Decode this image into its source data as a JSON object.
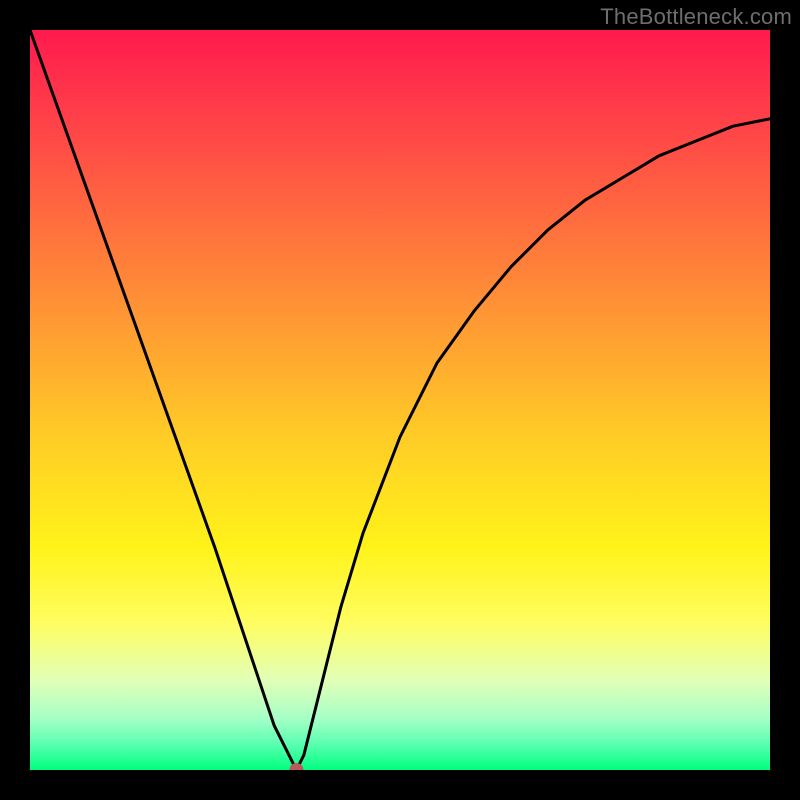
{
  "watermark": "TheBottleneck.com",
  "chart_data": {
    "type": "line",
    "title": "",
    "xlabel": "",
    "ylabel": "",
    "xlim": [
      0,
      100
    ],
    "ylim": [
      0,
      100
    ],
    "grid": false,
    "colors": {
      "curve": "#000000",
      "top": "#ff1a4d",
      "bottom": "#00ff7f",
      "frame": "#000000",
      "marker": "#b85a5a"
    },
    "marker": {
      "x": 36,
      "y": 0
    },
    "series": [
      {
        "name": "bottleneck-curve",
        "x": [
          0,
          5,
          10,
          15,
          20,
          25,
          28,
          31,
          33,
          35,
          36,
          37,
          38,
          40,
          42,
          45,
          50,
          55,
          60,
          65,
          70,
          75,
          80,
          85,
          90,
          95,
          100
        ],
        "y": [
          100,
          86,
          72,
          58,
          44,
          30,
          21,
          12,
          6,
          2,
          0,
          2,
          6,
          14,
          22,
          32,
          45,
          55,
          62,
          68,
          73,
          77,
          80,
          83,
          85,
          87,
          88
        ]
      }
    ]
  }
}
